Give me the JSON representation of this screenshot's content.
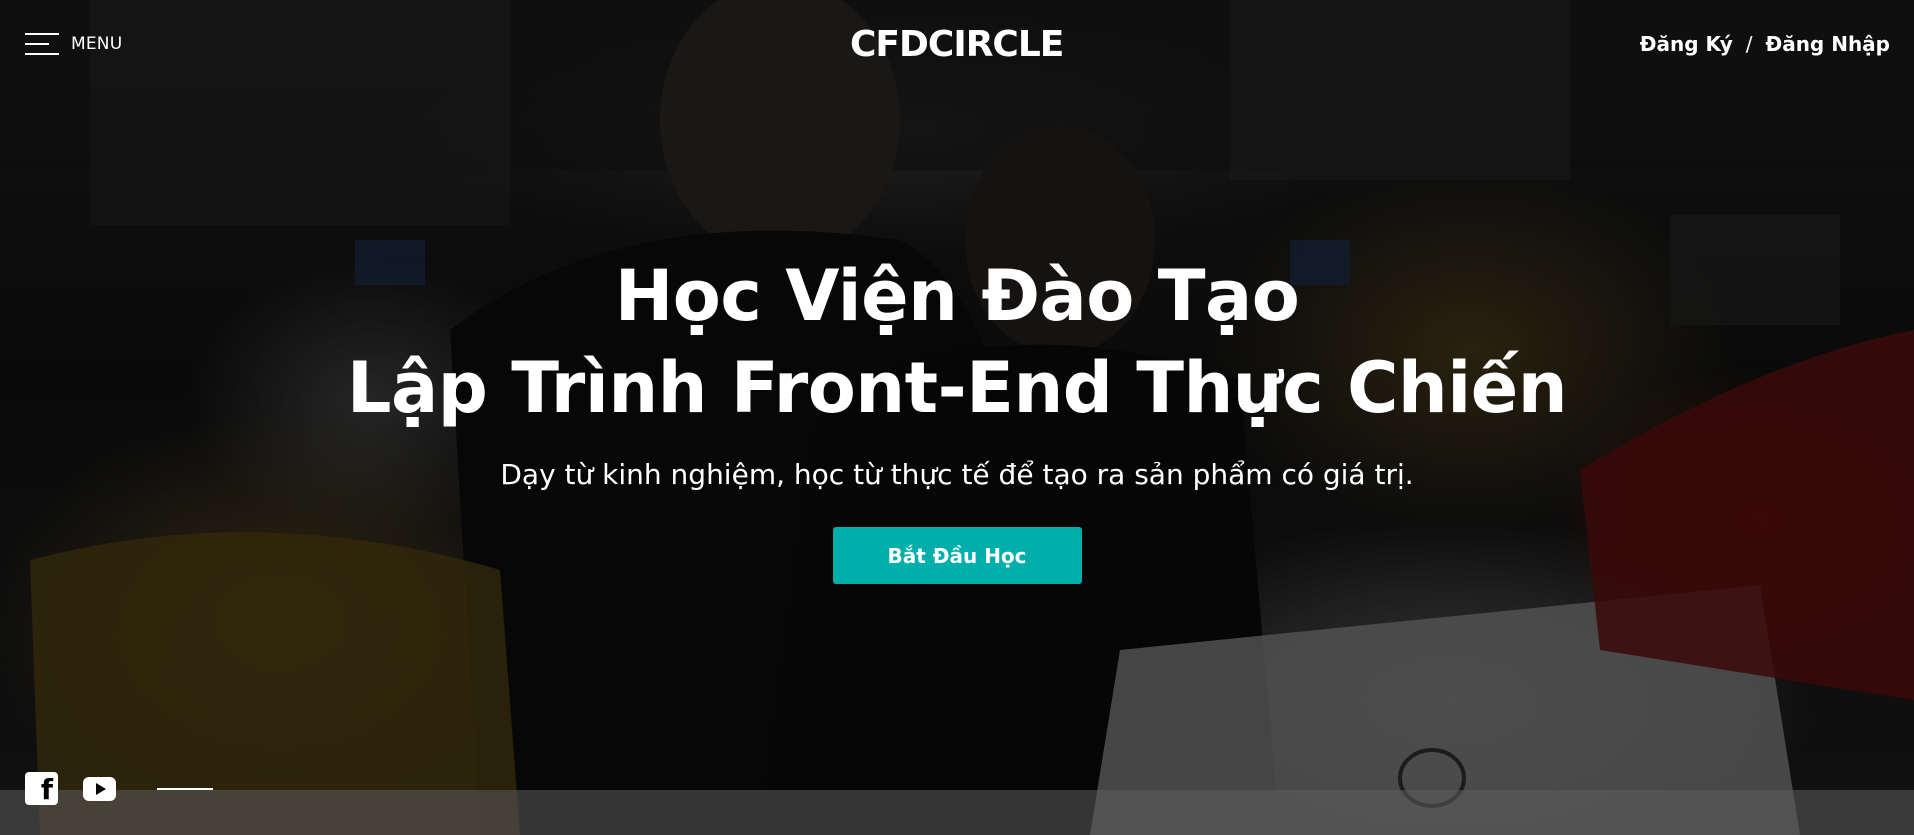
{
  "header": {
    "menu_label": "MENU",
    "logo_text": "CFDCIRCLE",
    "register_label": "Đăng Ký",
    "separator": "/",
    "login_label": "Đăng Nhập"
  },
  "hero": {
    "title_line1": "Học Viện Đào Tạo",
    "title_line2": "Lập Trình Front-End Thực Chiến",
    "subtitle": "Dạy từ kinh nghiệm, học từ thực tế để tạo ra sản phẩm có giá trị.",
    "cta_label": "Bắt Đầu Học"
  },
  "social": {
    "facebook_icon": "facebook-icon",
    "youtube_icon": "youtube-icon"
  },
  "colors": {
    "accent": "#00afab",
    "text": "#ffffff"
  }
}
